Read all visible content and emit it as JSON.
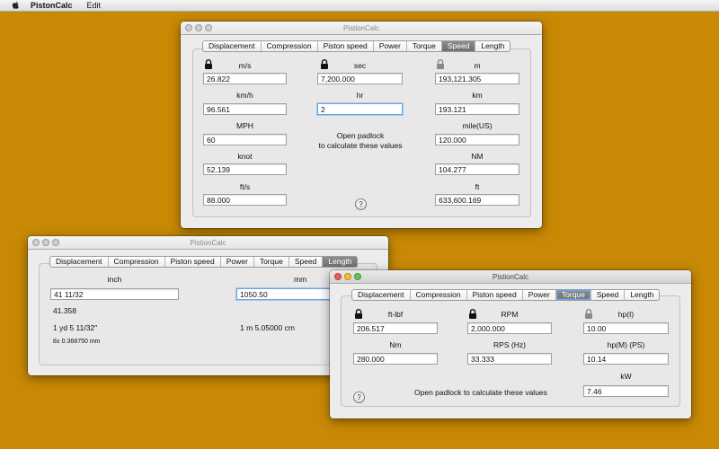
{
  "menubar": {
    "app": "PistonCalc",
    "edit": "Edit"
  },
  "colors": {
    "desktop": "#c88905",
    "selected_tab": "#7d7d7d",
    "focus_ring": "#6ca4de"
  },
  "icons": [
    "apple-icon",
    "padlock-closed-icon",
    "padlock-open-icon",
    "help-icon"
  ],
  "speed_window": {
    "title": "PistionCalc",
    "tabs": [
      "Displacement",
      "Compression",
      "Piston speed",
      "Power",
      "Torque",
      "Speed",
      "Length"
    ],
    "selected_tab": "Speed",
    "col1": [
      {
        "label": "m/s",
        "value": "26.822"
      },
      {
        "label": "km/h",
        "value": "96.561"
      },
      {
        "label": "MPH",
        "value": "60"
      },
      {
        "label": "knot",
        "value": "52.139"
      },
      {
        "label": "ft/s",
        "value": "88.000"
      }
    ],
    "col2": [
      {
        "label": "sec",
        "value": "7,200.000"
      },
      {
        "label": "hr",
        "value": "2"
      }
    ],
    "col3": [
      {
        "label": "m",
        "value": "193,121.305"
      },
      {
        "label": "km",
        "value": "193.121"
      },
      {
        "label": "mile(US)",
        "value": "120.000"
      },
      {
        "label": "NM",
        "value": "104.277"
      },
      {
        "label": "ft",
        "value": "633,600.169"
      }
    ],
    "note_line1": "Open padlock",
    "note_line2": "to calculate these values",
    "help": "?"
  },
  "length_window": {
    "title": "PistionCalc",
    "tabs": [
      "Displacement",
      "Compression",
      "Piston speed",
      "Power",
      "Torque",
      "Speed",
      "Length"
    ],
    "selected_tab": "Length",
    "inch_label": "inch",
    "inch_value": "41 11/32",
    "inch_decimal": "41.358",
    "yard_text": "1 yd 5 11/32\"",
    "small_text": "8± 0.368750 mm",
    "mm_label": "mm",
    "mm_value": "1050.50",
    "meter_text": "1 m 5.05000 cm"
  },
  "torque_window": {
    "title": "PistionCalc",
    "tabs": [
      "Displacement",
      "Compression",
      "Piston speed",
      "Power",
      "Torque",
      "Speed",
      "Length"
    ],
    "selected_tab": "Torque",
    "fields": [
      {
        "label": "ft-lbf",
        "value": "206.517"
      },
      {
        "label": "RPM",
        "value": "2,000.000"
      },
      {
        "label": "hp(I)",
        "value": "10.00"
      },
      {
        "label": "Nm",
        "value": "280.000"
      },
      {
        "label": "RPS (Hz)",
        "value": "33.333"
      },
      {
        "label": "hp(M) (PS)",
        "value": "10.14"
      },
      {
        "label": "kW",
        "value": "7.46"
      }
    ],
    "note": "Open padlock to calculate these values",
    "help": "?"
  }
}
